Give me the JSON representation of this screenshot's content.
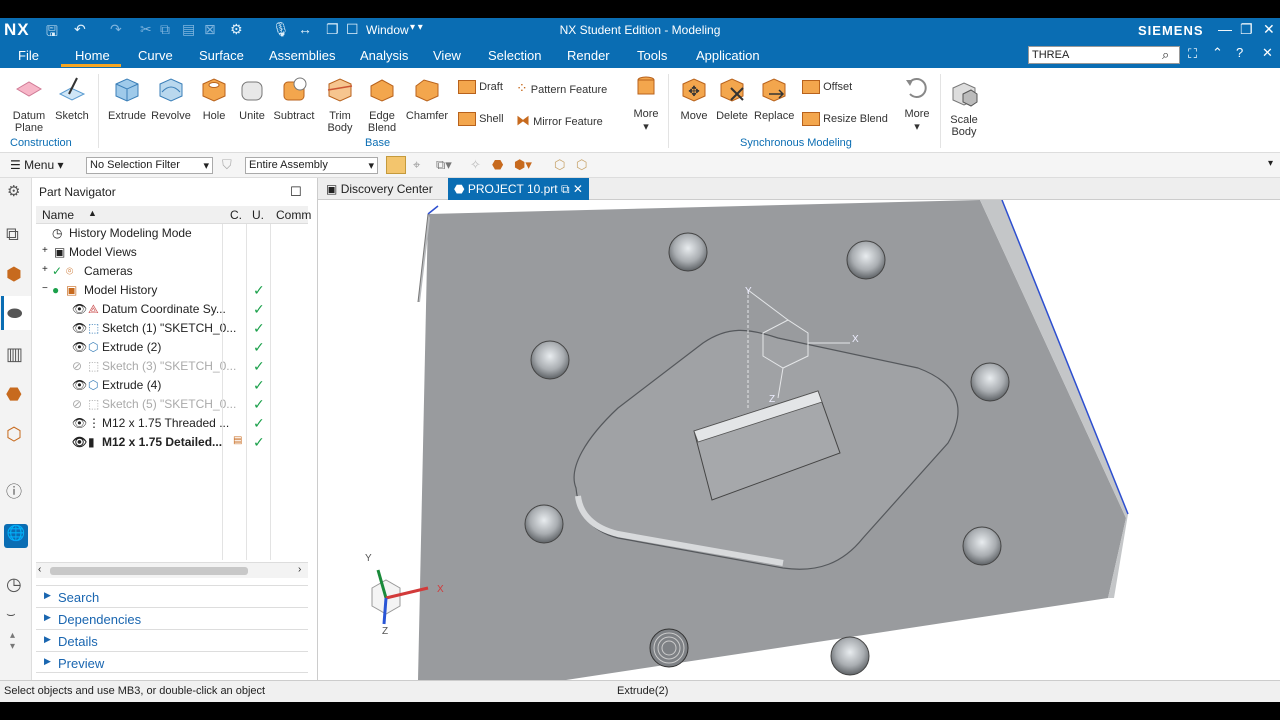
{
  "app": {
    "logo": "NX",
    "title": "NX Student Edition - Modeling",
    "brand": "SIEMENS",
    "window_menu": "Window"
  },
  "menu": {
    "file": "File",
    "tabs": [
      "Home",
      "Curve",
      "Surface",
      "Assemblies",
      "Analysis",
      "View",
      "Selection",
      "Render",
      "Tools",
      "Application"
    ],
    "active_tab": "Home",
    "search_value": "THREA"
  },
  "ribbon": {
    "construction": {
      "datum_plane": "Datum",
      "datum_plane2": "Plane",
      "sketch": "Sketch",
      "label": "Construction"
    },
    "base": {
      "extrude": "Extrude",
      "revolve": "Revolve",
      "hole": "Hole",
      "unite": "Unite",
      "subtract": "Subtract",
      "trim_body": "Trim",
      "trim_body2": "Body",
      "edge_blend": "Edge",
      "edge_blend2": "Blend",
      "chamfer": "Chamfer",
      "draft": "Draft",
      "shell": "Shell",
      "pattern_feature": "Pattern Feature",
      "mirror_feature": "Mirror Feature",
      "more": "More",
      "label": "Base"
    },
    "sync": {
      "move": "Move",
      "delete": "Delete",
      "replace": "Replace",
      "offset": "Offset",
      "resize_blend": "Resize Blend",
      "more": "More",
      "label": "Synchronous Modeling"
    },
    "scale_body": "Scale",
    "scale_body2": "Body"
  },
  "selection_bar": {
    "menu": "Menu",
    "filter": "No Selection Filter",
    "scope": "Entire Assembly"
  },
  "navigator": {
    "title": "Part Navigator",
    "columns": {
      "name": "Name",
      "c": "C.",
      "u": "U.",
      "comment": "Comm"
    },
    "rows": [
      {
        "label": "History Modeling Mode"
      },
      {
        "label": "Model Views"
      },
      {
        "label": "Cameras"
      },
      {
        "label": "Model History"
      },
      {
        "label": "Datum Coordinate Sy..."
      },
      {
        "label": "Sketch (1) \"SKETCH_0..."
      },
      {
        "label": "Extrude (2)"
      },
      {
        "label": "Sketch (3) \"SKETCH_0..."
      },
      {
        "label": "Extrude (4)"
      },
      {
        "label": "Sketch (5) \"SKETCH_0..."
      },
      {
        "label": "M12 x 1.75 Threaded ..."
      },
      {
        "label": "M12 x 1.75 Detailed..."
      }
    ],
    "panels": [
      "Search",
      "Dependencies",
      "Details",
      "Preview"
    ]
  },
  "tabs": {
    "discovery": "Discovery Center",
    "project": "PROJECT 10.prt"
  },
  "axes": {
    "x": "X",
    "y": "Y",
    "z": "Z"
  },
  "status": {
    "left": "Select objects and use MB3, or double-click an object",
    "center": "Extrude(2)"
  }
}
